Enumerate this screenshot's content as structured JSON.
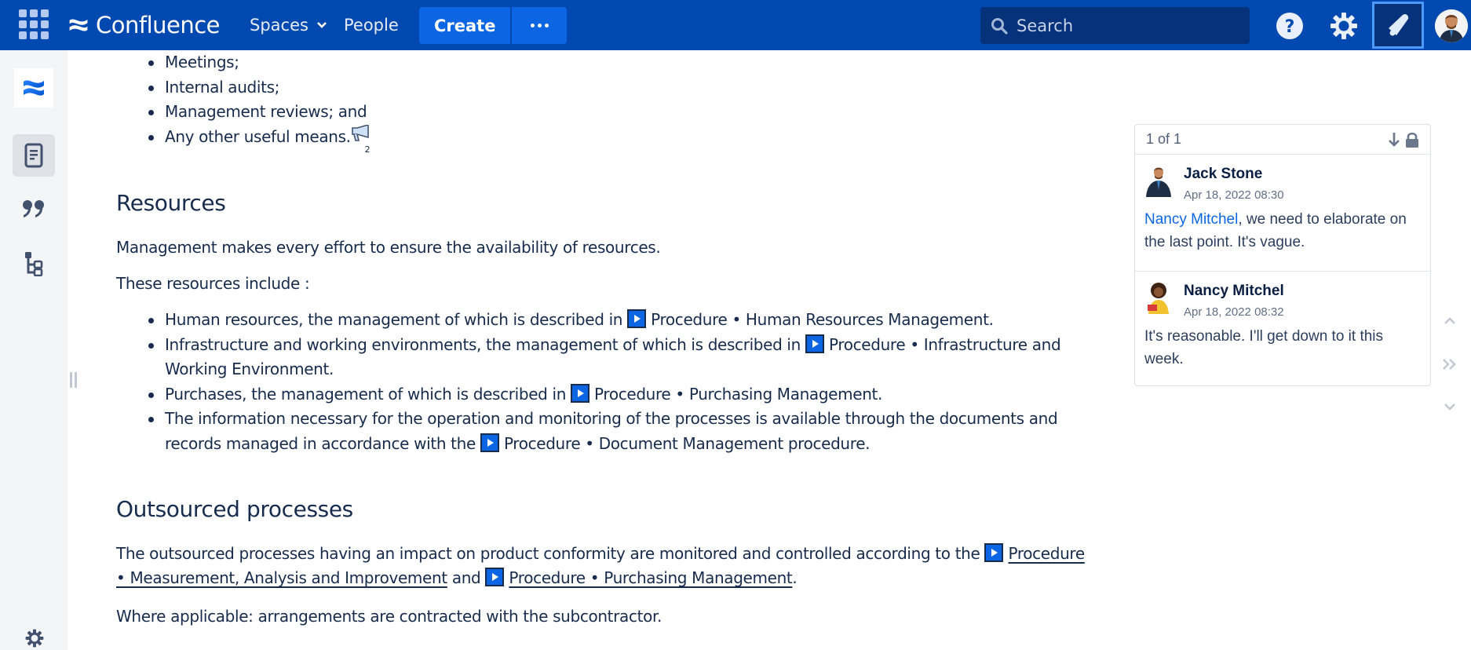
{
  "colors": {
    "topbar": "#0049b0",
    "create": "#0c66e4",
    "search_bg": "#05327a",
    "text": "#172b4d",
    "mention": "#0c66e4",
    "sidebar": "#f4f5f7"
  },
  "topbar": {
    "app_switcher_icon": "grid-icon",
    "brand": "Confluence",
    "nav": {
      "spaces": "Spaces",
      "people": "People"
    },
    "create_label": "Create",
    "more_icon": "ellipsis-icon",
    "search": {
      "placeholder": "Search",
      "value": ""
    },
    "icons": [
      "help-icon",
      "settings-icon",
      "notification-bell-icon",
      "user-avatar"
    ]
  },
  "sidebar": {
    "items": [
      {
        "name": "space-logo",
        "icon": "confluence-logo-icon"
      },
      {
        "name": "pages",
        "icon": "page-icon",
        "active": true
      },
      {
        "name": "blog",
        "icon": "quote-icon"
      },
      {
        "name": "page-tree",
        "icon": "hierarchy-icon"
      }
    ],
    "footer_icon": "settings-icon"
  },
  "content": {
    "top_list": [
      "Meetings;",
      "Internal audits;",
      "Management reviews; and",
      "Any other useful means."
    ],
    "feedback_count": "2",
    "resources": {
      "heading": "Resources",
      "para1": "Management makes every effort to ensure the availability of resources.",
      "para2": "These resources include :",
      "items": [
        {
          "text": "Human resources, the management of which is described in ",
          "link": "Procedure • Human Resources Management",
          "suffix": "."
        },
        {
          "text": "Infrastructure and working environments, the management of which is described in ",
          "link": "Procedure • Infrastructure and Working Environment",
          "suffix": "."
        },
        {
          "text": "Purchases, the management of which is described in ",
          "link": "Procedure • Purchasing Management",
          "suffix": "."
        },
        {
          "text": "The information necessary for the operation and monitoring of the processes is available through the documents and records managed in accordance with the ",
          "link": "Procedure • Document Management",
          "suffix": " procedure."
        }
      ]
    },
    "outsourced": {
      "heading": "Outsourced processes",
      "para_prefix": "The outsourced processes having an impact on product conformity are monitored and controlled according to the ",
      "link1": "Procedure • Measurement, Analysis and Improvement",
      "conj": " and ",
      "link2": "Procedure • Purchasing Management",
      "para_suffix": ".",
      "where": "Where applicable: arrangements are contracted with the subcontractor."
    }
  },
  "comments": {
    "counter": "1 of 1",
    "thread": [
      {
        "author": "Jack Stone",
        "time": "Apr 18, 2022 08:30",
        "mention": "Nancy Mitchel",
        "body": ", we need to elaborate on the last point. It's vague."
      },
      {
        "author": "Nancy Mitchel",
        "time": "Apr 18, 2022 08:32",
        "mention": "",
        "body": "It's reasonable. I'll get down to it this week."
      }
    ]
  }
}
